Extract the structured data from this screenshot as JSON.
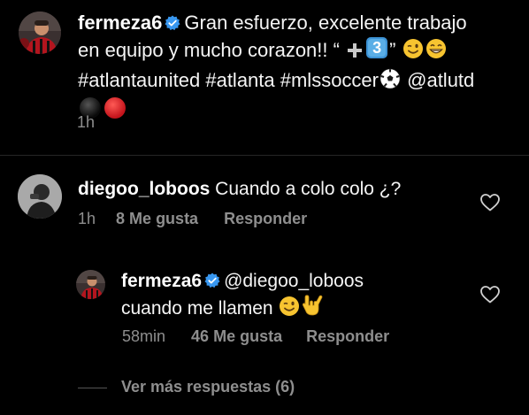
{
  "post": {
    "username": "fermeza6",
    "caption_line1": "Gran esfuerzo, excelente trabajo",
    "caption_line2": "en equipo y mucho corazon!! “",
    "caption_quote_close": "”",
    "caption_hashtags": "#atlantaunited #atlanta #mlssoccer",
    "caption_mention": "@atlutd",
    "time": "1h",
    "emoji_number": "3",
    "icons": [
      "verified-badge-icon",
      "plus-emoji-icon",
      "keycap-three-emoji-icon",
      "wink-emoji-icon",
      "grin-emoji-icon",
      "soccer-ball-emoji-icon",
      "black-circle-emoji-icon",
      "red-circle-emoji-icon"
    ]
  },
  "comment": {
    "username": "diegoo_loboos",
    "text": "Cuando a colo colo ¿?",
    "time": "1h",
    "likes": "8 Me gusta",
    "reply_label": "Responder"
  },
  "reply": {
    "username": "fermeza6",
    "mention": "@diegoo_loboos",
    "text": "cuando me llamen",
    "time": "58min",
    "likes": "46 Me gusta",
    "reply_label": "Responder",
    "icons": [
      "verified-badge-icon",
      "wink-emoji-icon",
      "love-you-gesture-emoji-icon"
    ]
  },
  "view_more": "Ver más respuestas (6)",
  "colors": {
    "background": "#000000",
    "text": "#ffffff",
    "muted": "#8e8e8e",
    "verified": "#3897f0",
    "emoji_yellow": "#f7c430",
    "red_circle": "#e0242b"
  }
}
